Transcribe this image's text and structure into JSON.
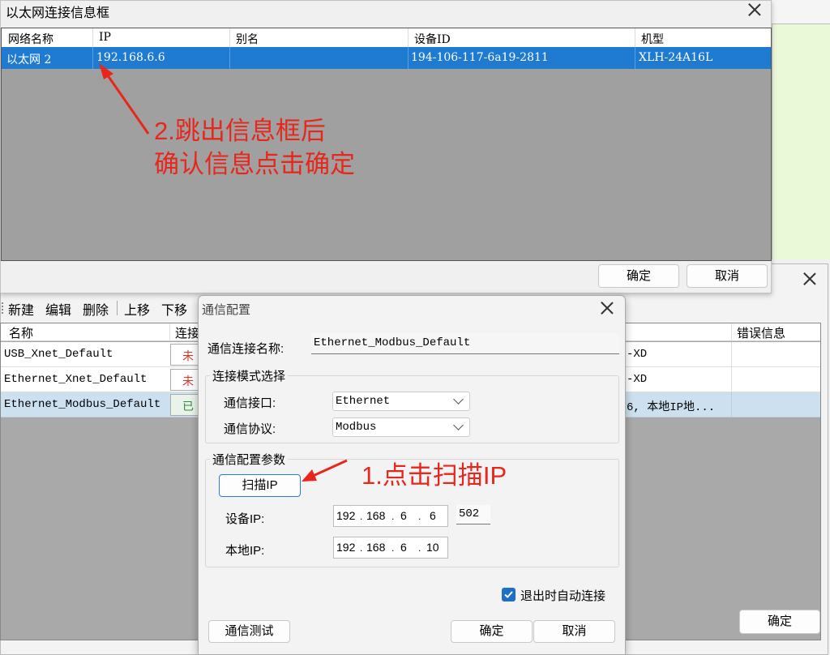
{
  "eth_dialog": {
    "title": "以太网连接信息框",
    "columns": [
      "网络名称",
      "IP",
      "别名",
      "设备ID",
      "机型"
    ],
    "row": {
      "network": "以太网 2",
      "ip": "192.168.6.6",
      "alias": "",
      "device_id": "194-106-117-6a19-2811",
      "model": "XLH-24A16L"
    },
    "ok_label": "确定",
    "cancel_label": "取消"
  },
  "annotations": {
    "step2_line1": "2.跳出信息框后",
    "step2_line2": "确认信息点击确定",
    "step1": "1.点击扫描IP",
    "color": "#e8271c"
  },
  "bg_window": {
    "toolbar": [
      "新建",
      "编辑",
      "删除",
      "上移",
      "下移"
    ],
    "columns": {
      "name": "名称",
      "conn": "连接",
      "error": "错误信息"
    },
    "rows": [
      {
        "name": "USB_Xnet_Default",
        "status": "未",
        "info": "-XD",
        "error": ""
      },
      {
        "name": "Ethernet_Xnet_Default",
        "status": "未",
        "info": "-XD",
        "error": ""
      },
      {
        "name": "Ethernet_Modbus_Default",
        "status": "已",
        "info": "6, 本地IP地...",
        "error": ""
      }
    ],
    "ok_label": "确定"
  },
  "comm_dialog": {
    "title": "通信配置",
    "conn_name_label": "通信连接名称:",
    "conn_name_value": "Ethernet_Modbus_Default",
    "mode_group": "连接模式选择",
    "interface_label": "通信接口:",
    "interface_value": "Ethernet",
    "protocol_label": "通信协议:",
    "protocol_value": "Modbus",
    "params_group": "通信配置参数",
    "scan_label": "扫描IP",
    "device_ip_label": "设备IP:",
    "device_ip": [
      "192",
      "168",
      "6",
      "6"
    ],
    "port": "502",
    "local_ip_label": "本地IP:",
    "local_ip": [
      "192",
      "168",
      "6",
      "10"
    ],
    "auto_connect_label": "退出时自动连接",
    "auto_connect_checked": true,
    "test_label": "通信测试",
    "ok_label": "确定",
    "cancel_label": "取消"
  }
}
